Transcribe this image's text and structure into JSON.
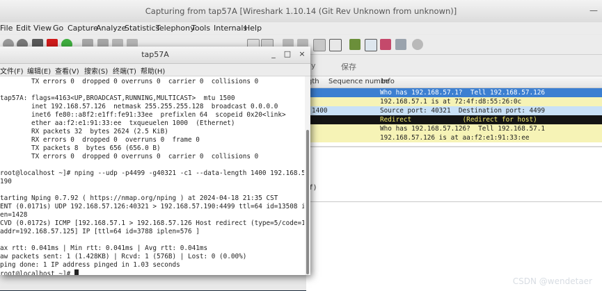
{
  "wireshark": {
    "title": "Capturing from tap57A   [Wireshark 1.10.14  (Git Rev Unknown from unknown)]",
    "minimize": "—",
    "menu": [
      "File",
      "Edit",
      "View",
      "Go",
      "Capture",
      "Analyze",
      "Statistics",
      "Telephony",
      "Tools",
      "Internals",
      "Help"
    ],
    "filter_apply_label": "ly",
    "filter_save_label": "保存",
    "columns": [
      "gth",
      "Sequence numbe",
      "Info"
    ],
    "packets": [
      {
        "c1": "",
        "info": "Who has 192.168.57.1?  Tell 192.168.57.126",
        "style": "selected"
      },
      {
        "c1": "",
        "info": "192.168.57.1 is at 72:4f:d8:55:26:0c",
        "style": "yellow"
      },
      {
        "c1": "1400",
        "info": "Source port: 40321  Destination port: 4499",
        "style": "blue"
      },
      {
        "c1": "",
        "info": "Redirect             (Redirect for host)",
        "style": "black"
      },
      {
        "c1": "",
        "info": "Who has 192.168.57.126?  Tell 192.168.57.1",
        "style": "yellow"
      },
      {
        "c1": "",
        "info": "192.168.57.126 is at aa:f2:e1:91:33:ee",
        "style": "yellow"
      }
    ],
    "detail_fragment": "f)"
  },
  "terminal": {
    "title": "tap57A",
    "buttons": [
      "_",
      "□",
      "×"
    ],
    "menu": [
      "文件(F)",
      "编辑(E)",
      "查看(V)",
      "搜索(S)",
      "终端(T)",
      "帮助(H)"
    ],
    "lines": [
      "        TX errors 0  dropped 0 overruns 0  carrier 0  collisions 0",
      "",
      "tap57A: flags=4163<UP,BROADCAST,RUNNING,MULTICAST>  mtu 1500",
      "        inet 192.168.57.126  netmask 255.255.255.128  broadcast 0.0.0.0",
      "        inet6 fe80::a8f2:e1ff:fe91:33ee  prefixlen 64  scopeid 0x20<link>",
      "        ether aa:f2:e1:91:33:ee  txqueuelen 1000  (Ethernet)",
      "        RX packets 32  bytes 2624 (2.5 KiB)",
      "        RX errors 0  dropped 0  overruns 0  frame 0",
      "        TX packets 8  bytes 656 (656.0 B)",
      "        TX errors 0  dropped 0 overruns 0  carrier 0  collisions 0",
      "",
      "root@localhost ~]# nping --udp -p4499 -g40321 -c1 --data-length 1400 192.168.57",
      "190",
      "",
      "tarting Nping 0.7.92 ( https://nmap.org/nping ) at 2024-04-18 21:35 CST",
      "ENT (0.0171s) UDP 192.168.57.126:40321 > 192.168.57.190:4499 ttl=64 id=13508 ip",
      "en=1428",
      "CVD (0.0172s) ICMP [192.168.57.1 > 192.168.57.126 Host redirect (type=5/code=1)",
      "addr=192.168.57.125] IP [ttl=64 id=3788 iplen=576 ]",
      "",
      "ax rtt: 0.041ms | Min rtt: 0.041ms | Avg rtt: 0.041ms",
      "aw packets sent: 1 (1.428KB) | Rcvd: 1 (576B) | Lost: 0 (0.00%)",
      "ping done: 1 IP address pinged in 1.03 seconds",
      "root@localhost ~]# "
    ]
  },
  "watermark": "CSDN @wendetaer",
  "colors": {
    "selected_row": "#3c7fd1",
    "yellow_row": "#f6f3b6",
    "blue_row": "#c9e1f7",
    "black_row": "#141414",
    "black_row_text": "#f5ec6c"
  }
}
